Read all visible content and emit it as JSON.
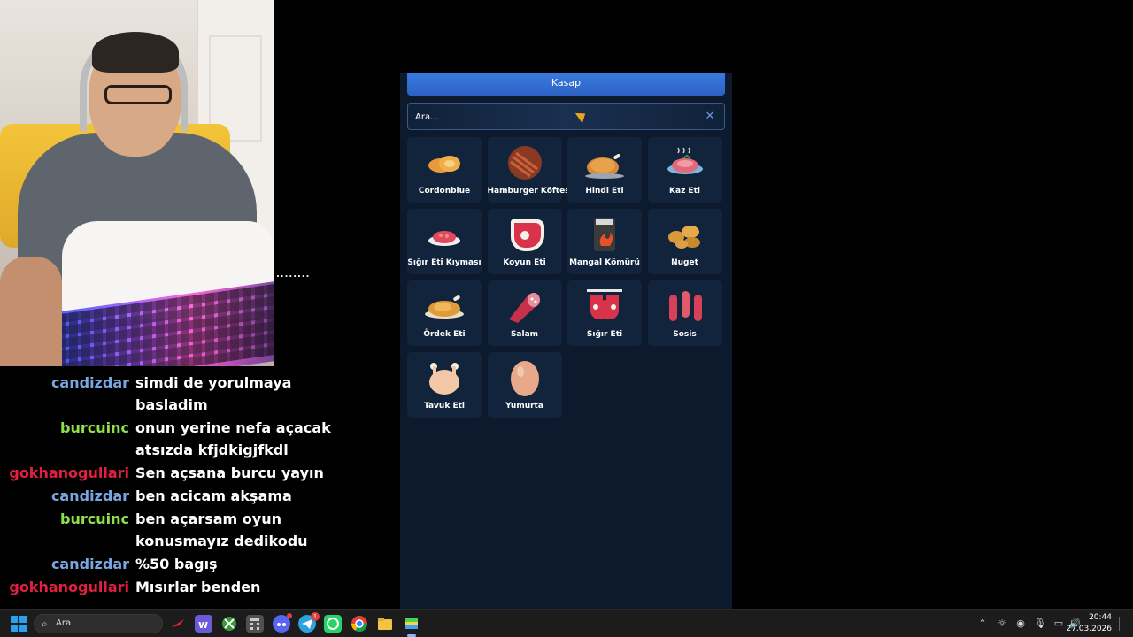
{
  "stream_overlay": {
    "divider_dots": "........"
  },
  "chat": [
    {
      "user": "candizdar",
      "user_color": "#7aa6e0",
      "lines": [
        "simdi de yorulmaya",
        "basladim"
      ]
    },
    {
      "user": "burcuinc",
      "user_color": "#8ee04a",
      "lines": [
        "onun yerine nefa açacak",
        "atsızda kfjdkigjfkdl"
      ]
    },
    {
      "user": "gokhanogullari",
      "user_color": "#e0203e",
      "lines": [
        "Sen açsana burcu yayın"
      ]
    },
    {
      "user": "candizdar",
      "user_color": "#7aa6e0",
      "lines": [
        "ben acicam akşama"
      ]
    },
    {
      "user": "burcuinc",
      "user_color": "#8ee04a",
      "lines": [
        "ben açarsam oyun",
        "konusmayız dedikodu"
      ]
    },
    {
      "user": "candizdar",
      "user_color": "#7aa6e0",
      "lines": [
        "%50 bagış"
      ]
    },
    {
      "user": "gokhanogullari",
      "user_color": "#e0203e",
      "lines": [
        "Mısırlar benden"
      ]
    }
  ],
  "game": {
    "title": "Kasap",
    "search": {
      "placeholder": "Ara...",
      "value": ""
    },
    "items": [
      {
        "label": "Cordonblue",
        "icon": "cordon-bleu-icon"
      },
      {
        "label": "Hamburger Köftesi",
        "icon": "burger-patty-icon"
      },
      {
        "label": "Hindi Eti",
        "icon": "roast-turkey-icon"
      },
      {
        "label": "Kaz Eti",
        "icon": "goose-meat-icon"
      },
      {
        "label": "Sığır Eti Kıyması",
        "icon": "minced-beef-icon"
      },
      {
        "label": "Koyun Eti",
        "icon": "mutton-steak-icon"
      },
      {
        "label": "Mangal Kömürü",
        "icon": "charcoal-bag-icon"
      },
      {
        "label": "Nuget",
        "icon": "nuggets-icon"
      },
      {
        "label": "Ördek Eti",
        "icon": "duck-meat-icon"
      },
      {
        "label": "Salam",
        "icon": "salami-icon"
      },
      {
        "label": "Sığır Eti",
        "icon": "beef-cuts-icon"
      },
      {
        "label": "Sosis",
        "icon": "sausage-icon"
      },
      {
        "label": "Tavuk Eti",
        "icon": "chicken-icon"
      },
      {
        "label": "Yumurta",
        "icon": "egg-icon"
      }
    ]
  },
  "taskbar": {
    "search_label": "Ara",
    "clock_time": "20:44",
    "clock_date": "27.03.2026",
    "telegram_badge": "1"
  }
}
